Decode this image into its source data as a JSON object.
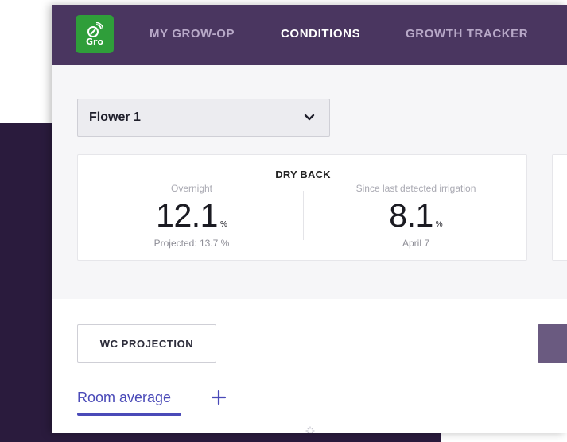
{
  "logo": {
    "text": "Gro"
  },
  "nav": {
    "items": [
      "MY GROW-OP",
      "CONDITIONS",
      "GROWTH TRACKER"
    ],
    "active": "CONDITIONS"
  },
  "room_select": {
    "value": "Flower 1"
  },
  "dry_back": {
    "title": "DRY BACK",
    "overnight": {
      "label": "Overnight",
      "value": "12.1",
      "unit": "%",
      "sub": "Projected: 13.7 %"
    },
    "since_irrigation": {
      "label": "Since last detected irrigation",
      "value": "8.1",
      "unit": "%",
      "sub": "April 7"
    }
  },
  "wc_projection_button": "WC PROJECTION",
  "tabs": {
    "room_average": "Room average"
  },
  "colors": {
    "nav_bg": "#4a3660",
    "logo_green": "#2f9e3a",
    "accent": "#4a4ab8",
    "background_dark": "#2a1b3d"
  },
  "icons": [
    "wifi-leaf-logo-icon",
    "chevron-down-icon",
    "plus-icon",
    "loading-spinner-icon"
  ]
}
